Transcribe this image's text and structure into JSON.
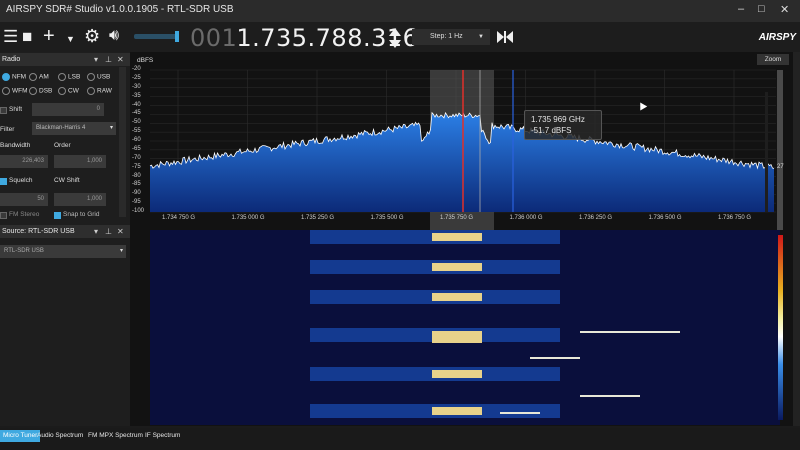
{
  "window": {
    "title": "AIRSPY SDR# Studio v1.0.0.1905 - RTL-SDR USB",
    "controls": [
      "–",
      "□",
      "✕"
    ]
  },
  "toolbar": {
    "icons": [
      "menu-icon",
      "stop-icon",
      "add-icon",
      "chevron-down-icon",
      "gear-icon",
      "speaker-icon"
    ],
    "frequency_dim": "001",
    "frequency_main": ".735.788.316",
    "step_label": "Step: 1 Hz",
    "logo": "AIRSPY"
  },
  "radio_panel": {
    "title": "Radio",
    "modes": [
      {
        "label": "NFM",
        "selected": true
      },
      {
        "label": "AM",
        "selected": false
      },
      {
        "label": "LSB",
        "selected": false
      },
      {
        "label": "USB",
        "selected": false
      },
      {
        "label": "WFM",
        "selected": false
      },
      {
        "label": "DSB",
        "selected": false
      },
      {
        "label": "CW",
        "selected": false
      },
      {
        "label": "RAW",
        "selected": false
      }
    ],
    "shift_label": "Shift",
    "shift_value": "0",
    "filter_label": "Filter",
    "filter_value": "Blackman-Harris 4",
    "bandwidth_label": "Bandwidth",
    "bandwidth_value": "226,403",
    "order_label": "Order",
    "order_value": "1,000",
    "squelch_label": "Squelch",
    "squelch_value": "50",
    "cw_shift_label": "CW Shift",
    "cw_shift_value": "1,000",
    "fm_stereo_label": "FM Stereo",
    "snap_to_grid_label": "Snap to Grid"
  },
  "source_panel": {
    "title": "Source: RTL-SDR USB",
    "device": "RTL-SDR USB"
  },
  "spectrum": {
    "y_unit": "dBFS",
    "y_ticks": [
      "-20",
      "-25",
      "-30",
      "-35",
      "-40",
      "-45",
      "-50",
      "-55",
      "-60",
      "-65",
      "-70",
      "-75",
      "-80",
      "-85",
      "-90",
      "-95",
      "-100"
    ],
    "x_ticks": [
      "1.734 750 G",
      "1.735 000 G",
      "1.735 250 G",
      "1.735 500 G",
      "1.735 750 G",
      "1.736 000 G",
      "1.736 250 G",
      "1.736 500 G",
      "1.736 750 G"
    ],
    "zoom_label": "Zoom",
    "tooltip_freq": "1.735 969 GHz",
    "tooltip_level": "-51.7 dBFS",
    "right_value": "27"
  },
  "bottom_tabs": [
    {
      "label": "Micro Tuner",
      "active": true
    },
    {
      "label": "Audio Spectrum",
      "active": false
    },
    {
      "label": "FM MPX Spectrum",
      "active": false
    },
    {
      "label": "IF Spectrum",
      "active": false
    }
  ],
  "colors": {
    "accent": "#3fa9e0",
    "trace": "#ffffff",
    "fill": "#1e5fd0",
    "marker_red": "#e0302a",
    "marker_blue": "#2a62e0"
  }
}
